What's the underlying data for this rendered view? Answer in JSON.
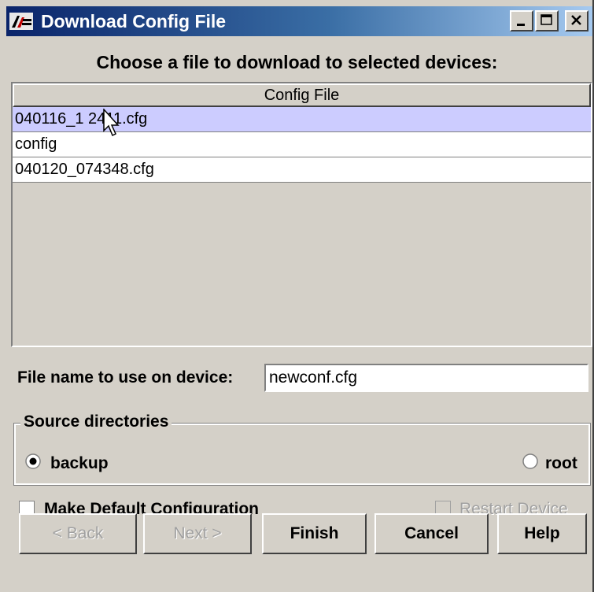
{
  "window": {
    "title": "Download Config File",
    "controls": [
      "minimize",
      "maximize",
      "close"
    ]
  },
  "heading": "Choose a file to download to selected devices:",
  "file_list": {
    "column_header": "Config File",
    "rows": [
      "040116_1 2411.cfg",
      "config",
      "040120_074348.cfg"
    ],
    "selected_index": 0
  },
  "file_name": {
    "label": "File name to use on device:",
    "value": "newconf.cfg"
  },
  "source_directories": {
    "title": "Source directories",
    "options": [
      {
        "label": "backup",
        "selected": true
      },
      {
        "label": "root",
        "selected": false
      }
    ]
  },
  "options": {
    "make_default": {
      "label": "Make Default Configuration",
      "checked": false,
      "enabled": true
    },
    "restart_device": {
      "label": "Restart Device",
      "checked": false,
      "enabled": false
    }
  },
  "buttons": {
    "back": {
      "label": "< Back",
      "enabled": false
    },
    "next": {
      "label": "Next >",
      "enabled": false
    },
    "finish": {
      "label": "Finish",
      "enabled": true
    },
    "cancel": {
      "label": "Cancel",
      "enabled": true
    },
    "help": {
      "label": "Help",
      "enabled": true
    }
  },
  "colors": {
    "title_bar_start": "#0a246a",
    "title_bar_end": "#a6caf0",
    "selected_row": "#ccccff",
    "window_bg": "#d4d0c8"
  }
}
